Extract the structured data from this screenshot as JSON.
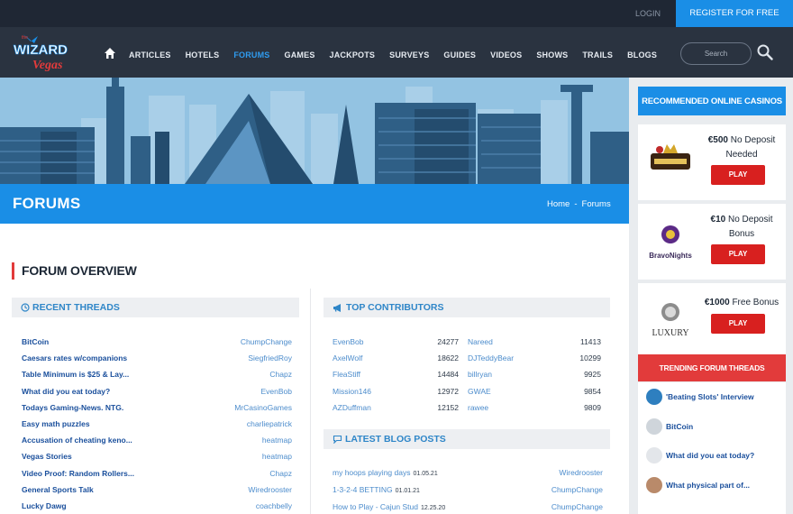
{
  "topbar": {
    "login": "LOGIN",
    "register": "REGISTER FOR FREE"
  },
  "logo": {
    "line1": "WIZARD",
    "line2": "Vegas",
    "small": "the"
  },
  "nav": [
    "ARTICLES",
    "HOTELS",
    "FORUMS",
    "GAMES",
    "JACKPOTS",
    "SURVEYS",
    "GUIDES",
    "VIDEOS",
    "SHOWS",
    "TRAILS",
    "BLOGS"
  ],
  "nav_active": "FORUMS",
  "search": {
    "placeholder": "Search"
  },
  "page": {
    "title": "FORUMS",
    "breadcrumb": [
      "Home",
      "-",
      "Forums"
    ]
  },
  "overview": {
    "title": "FORUM OVERVIEW"
  },
  "recent_threads": {
    "heading": "RECENT THREADS",
    "rows": [
      {
        "title": "BitCoin",
        "user": "ChumpChange"
      },
      {
        "title": "Caesars rates w/companions",
        "user": "SiegfriedRoy"
      },
      {
        "title": "Table Minimum is $25 & Lay...",
        "user": "Chapz"
      },
      {
        "title": "What did you eat today?",
        "user": "EvenBob"
      },
      {
        "title": "Todays Gaming-News. NTG.",
        "user": "MrCasinoGames"
      },
      {
        "title": "Easy math puzzles",
        "user": "charliepatrick"
      },
      {
        "title": "Accusation of cheating keno...",
        "user": "heatmap"
      },
      {
        "title": "Vegas Stories",
        "user": "heatmap"
      },
      {
        "title": "Video Proof: Random Rollers...",
        "user": "Chapz"
      },
      {
        "title": "General Sports Talk",
        "user": "Wiredrooster"
      },
      {
        "title": "Lucky Dawg",
        "user": "coachbelly"
      }
    ]
  },
  "top_contributors": {
    "heading": "TOP CONTRIBUTORS",
    "rows": [
      {
        "name1": "EvenBob",
        "count1": "24277",
        "name2": "Nareed",
        "count2": "11413"
      },
      {
        "name1": "AxelWolf",
        "count1": "18622",
        "name2": "DJTeddyBear",
        "count2": "10299"
      },
      {
        "name1": "FleaStiff",
        "count1": "14484",
        "name2": "billryan",
        "count2": "9925"
      },
      {
        "name1": "Mission146",
        "count1": "12972",
        "name2": "GWAE",
        "count2": "9854"
      },
      {
        "name1": "AZDuffman",
        "count1": "12152",
        "name2": "rawee",
        "count2": "9809"
      }
    ]
  },
  "latest_blogs": {
    "heading": "LATEST BLOG POSTS",
    "rows": [
      {
        "title": "my hoops playing days",
        "date": "01.05.21",
        "user": "Wiredrooster"
      },
      {
        "title": "1-3-2-4 BETTING",
        "date": "01.01.21",
        "user": "ChumpChange"
      },
      {
        "title": "How to Play - Cajun Stud",
        "date": "12.25.20",
        "user": "ChumpChange"
      }
    ]
  },
  "sidebar": {
    "recommended_heading": "RECOMMENDED ONLINE CASINOS",
    "casinos": [
      {
        "offer_bold": "€500",
        "offer_rest": "No Deposit Needed",
        "play": "PLAY",
        "logo_text": ""
      },
      {
        "offer_bold": "€10",
        "offer_rest": "No Deposit Bonus",
        "play": "PLAY",
        "logo_text": "BravoNights"
      },
      {
        "offer_bold": "€1000",
        "offer_rest": "Free Bonus",
        "play": "PLAY",
        "logo_text": "LUXURY"
      }
    ],
    "trending_heading": "TRENDING FORUM THREADS",
    "trending": [
      {
        "title": "'Beating Slots' Interview"
      },
      {
        "title": "BitCoin"
      },
      {
        "title": "What did you eat today?"
      },
      {
        "title": "What physical part of..."
      }
    ]
  },
  "colors": {
    "brand_blue": "#1a8ee6",
    "dark_nav": "#2a3340",
    "accent_red": "#e23b3b",
    "play_red": "#d8201f"
  }
}
